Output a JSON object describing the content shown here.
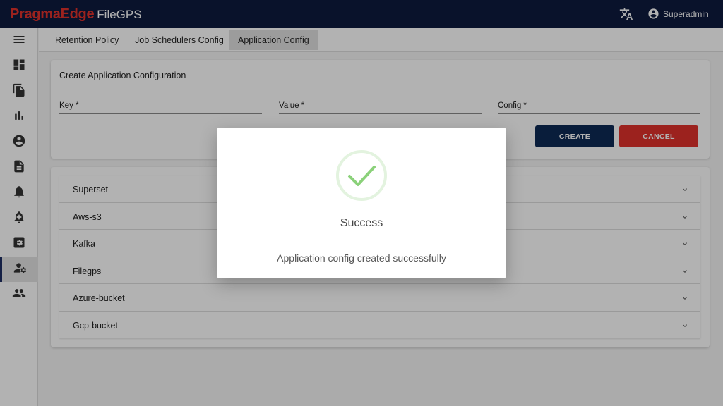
{
  "header": {
    "brand_logo": "PragmaEdge",
    "app_name": "FileGPS",
    "translate_icon": "translate-icon",
    "user_icon": "account-circle-icon",
    "user_name": "Superadmin"
  },
  "sidebar": {
    "items": [
      {
        "name": "menu-icon"
      },
      {
        "name": "dashboard-icon"
      },
      {
        "name": "file-copy-icon"
      },
      {
        "name": "bar-chart-icon"
      },
      {
        "name": "account-circle-icon"
      },
      {
        "name": "description-icon"
      },
      {
        "name": "notification-bell-icon"
      },
      {
        "name": "notification-add-icon"
      },
      {
        "name": "settings-box-icon"
      },
      {
        "name": "user-settings-icon",
        "active": true
      },
      {
        "name": "people-icon"
      }
    ]
  },
  "tabs": [
    {
      "label": "Retention Policy"
    },
    {
      "label": "Job Schedulers Config"
    },
    {
      "label": "Application Config",
      "active": true
    }
  ],
  "form": {
    "title": "Create Application Configuration",
    "key_label": "Key *",
    "value_label": "Value *",
    "config_label": "Config *",
    "create_label": "CREATE",
    "cancel_label": "CANCEL"
  },
  "panels": [
    {
      "label": "Superset"
    },
    {
      "label": "Aws-s3"
    },
    {
      "label": "Kafka"
    },
    {
      "label": "Filegps"
    },
    {
      "label": "Azure-bucket"
    },
    {
      "label": "Gcp-bucket"
    }
  ],
  "dialog": {
    "icon": "check-circle-icon",
    "title": "Success",
    "message": "Application config created successfully"
  },
  "colors": {
    "topbar": "#0e1a3e",
    "brand_red": "#e0322b",
    "create_button": "#0e2a55",
    "cancel_button": "#e0322b",
    "success_green": "#8bd17a"
  }
}
